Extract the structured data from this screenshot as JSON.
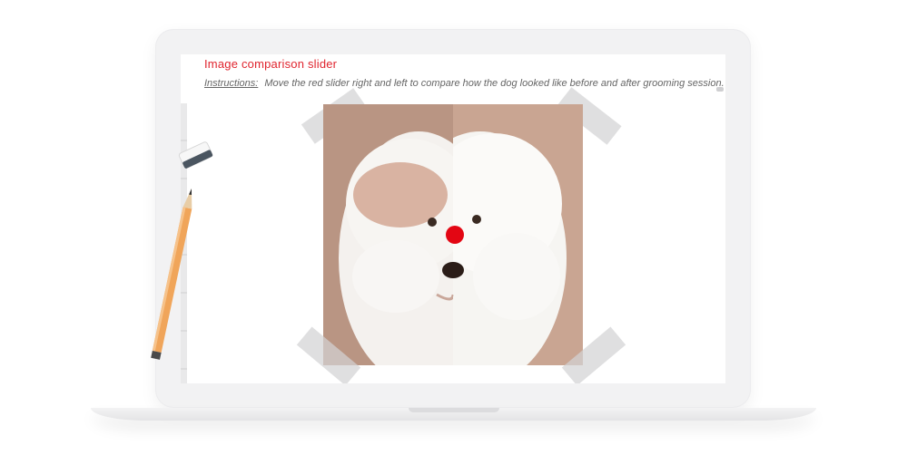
{
  "page": {
    "title": "Image comparison slider",
    "instructions_label": "Instructions:",
    "instructions_text": "Move the red slider right and left to compare how the dog looked like before and after grooming session."
  },
  "slider": {
    "position": 0.5,
    "knob_color": "#e30613",
    "title_color": "#e0242e"
  },
  "images": {
    "before": "dog-before-grooming",
    "after": "dog-after-grooming"
  },
  "colors": {
    "photo_background": "#c59e8c",
    "frame": "#f2f2f3"
  },
  "decor": {
    "icons": [
      "eraser-icon",
      "pencil-icon",
      "tape-strip"
    ]
  }
}
